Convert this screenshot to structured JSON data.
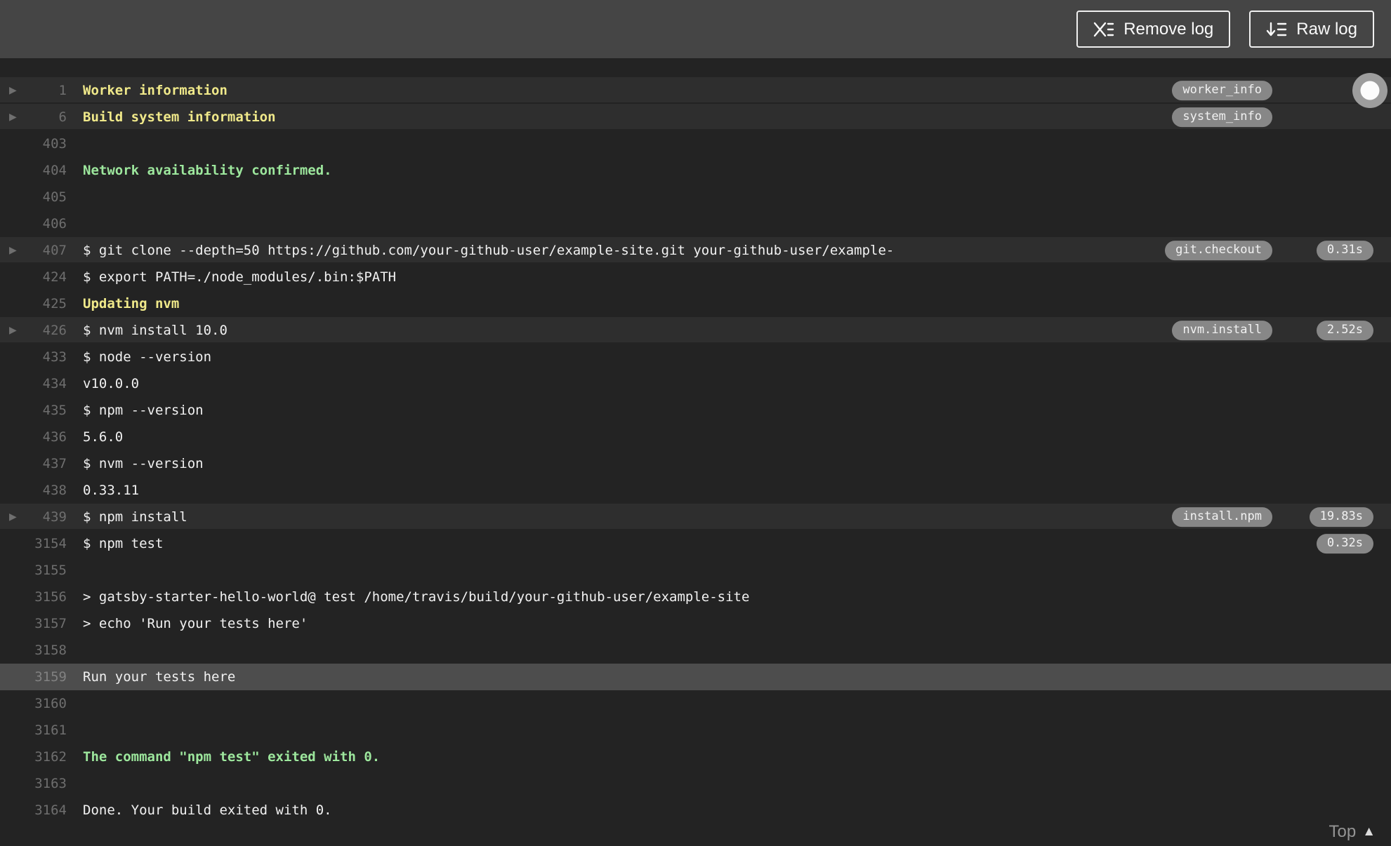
{
  "header": {
    "remove_log_label": "Remove log",
    "raw_log_label": "Raw log"
  },
  "icons": {
    "fold_arrow": "▶",
    "caret_up": "▲"
  },
  "colors": {
    "header_bg": "#454545",
    "log_bg": "#232323",
    "ansi_yellow": "#f0e98a",
    "ansi_green": "#9de79d"
  },
  "footer": {
    "top_label": "Top"
  },
  "log": {
    "rows": [
      {
        "num": "1",
        "text": "Worker information",
        "color": "yellow",
        "fold": true,
        "highlight": true,
        "tag": "worker_info"
      },
      {
        "num": "6",
        "text": "Build system information",
        "color": "yellow",
        "fold": true,
        "highlight": true,
        "tag": "system_info"
      },
      {
        "num": "403",
        "text": ""
      },
      {
        "num": "404",
        "text": "Network availability confirmed.",
        "color": "green"
      },
      {
        "num": "405",
        "text": ""
      },
      {
        "num": "406",
        "text": ""
      },
      {
        "num": "407",
        "text": "$ git clone --depth=50 https://github.com/your-github-user/example-site.git your-github-user/example-",
        "fold": true,
        "highlight": true,
        "tag": "git.checkout",
        "time": "0.31s"
      },
      {
        "num": "424",
        "text": "$ export PATH=./node_modules/.bin:$PATH"
      },
      {
        "num": "425",
        "text": "Updating nvm",
        "color": "yellow"
      },
      {
        "num": "426",
        "text": "$ nvm install 10.0",
        "fold": true,
        "highlight": true,
        "tag": "nvm.install",
        "time": "2.52s"
      },
      {
        "num": "433",
        "text": "$ node --version"
      },
      {
        "num": "434",
        "text": "v10.0.0"
      },
      {
        "num": "435",
        "text": "$ npm --version"
      },
      {
        "num": "436",
        "text": "5.6.0"
      },
      {
        "num": "437",
        "text": "$ nvm --version"
      },
      {
        "num": "438",
        "text": "0.33.11"
      },
      {
        "num": "439",
        "text": "$ npm install",
        "fold": true,
        "highlight": true,
        "tag": "install.npm",
        "time": "19.83s"
      },
      {
        "num": "3154",
        "text": "$ npm test",
        "time": "0.32s"
      },
      {
        "num": "3155",
        "text": ""
      },
      {
        "num": "3156",
        "text": "> gatsby-starter-hello-world@ test /home/travis/build/your-github-user/example-site"
      },
      {
        "num": "3157",
        "text": "> echo 'Run your tests here'"
      },
      {
        "num": "3158",
        "text": ""
      },
      {
        "num": "3159",
        "text": "Run your tests here",
        "selected": true
      },
      {
        "num": "3160",
        "text": ""
      },
      {
        "num": "3161",
        "text": ""
      },
      {
        "num": "3162",
        "text": "The command \"npm test\" exited with 0.",
        "color": "green"
      },
      {
        "num": "3163",
        "text": ""
      },
      {
        "num": "3164",
        "text": "Done. Your build exited with 0."
      }
    ]
  }
}
